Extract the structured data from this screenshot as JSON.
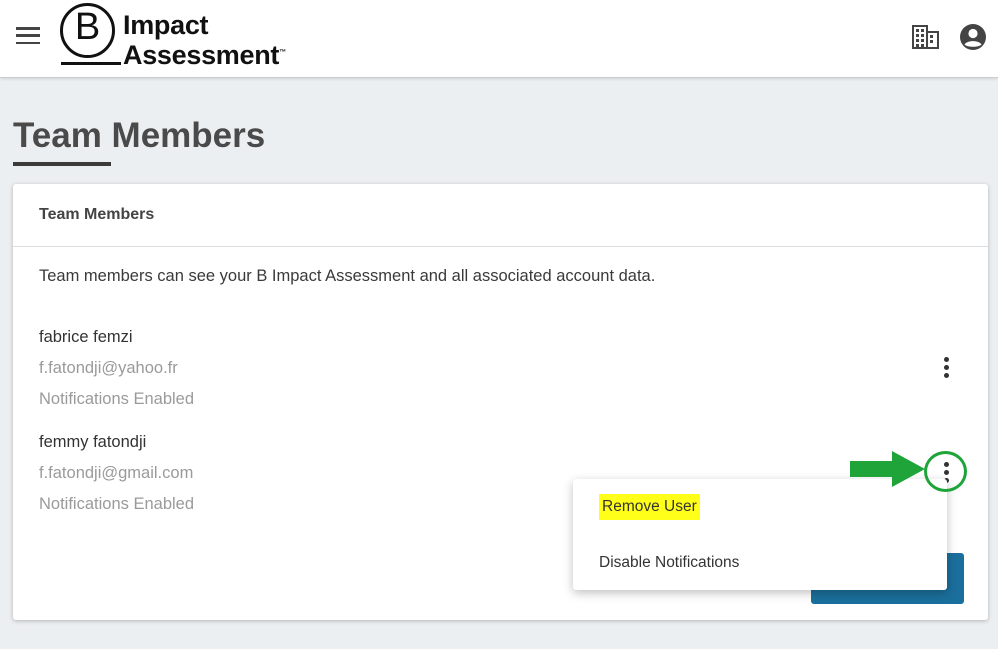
{
  "header": {
    "logo_letter": "B",
    "logo_line1": "Impact",
    "logo_line2": "Assessment",
    "logo_tm": "™"
  },
  "page": {
    "title": "Team Members"
  },
  "card": {
    "header": "Team Members",
    "description": "Team members can see your B Impact Assessment and all associated account data."
  },
  "members": [
    {
      "name": "fabrice femzi",
      "email": "f.fatondji@yahoo.fr",
      "notifications": "Notifications Enabled"
    },
    {
      "name": "femmy fatondji",
      "email": "f.fatondji@gmail.com",
      "notifications": "Notifications Enabled"
    }
  ],
  "menu": {
    "remove_user": "Remove User",
    "disable_notifications": "Disable Notifications"
  },
  "colors": {
    "primary_button": "#1b6f9c",
    "highlight": "#ffff1a",
    "annotation": "#1fa43a"
  },
  "icons": [
    "menu-icon",
    "building-icon",
    "account-circle-icon",
    "more-vert-icon"
  ]
}
